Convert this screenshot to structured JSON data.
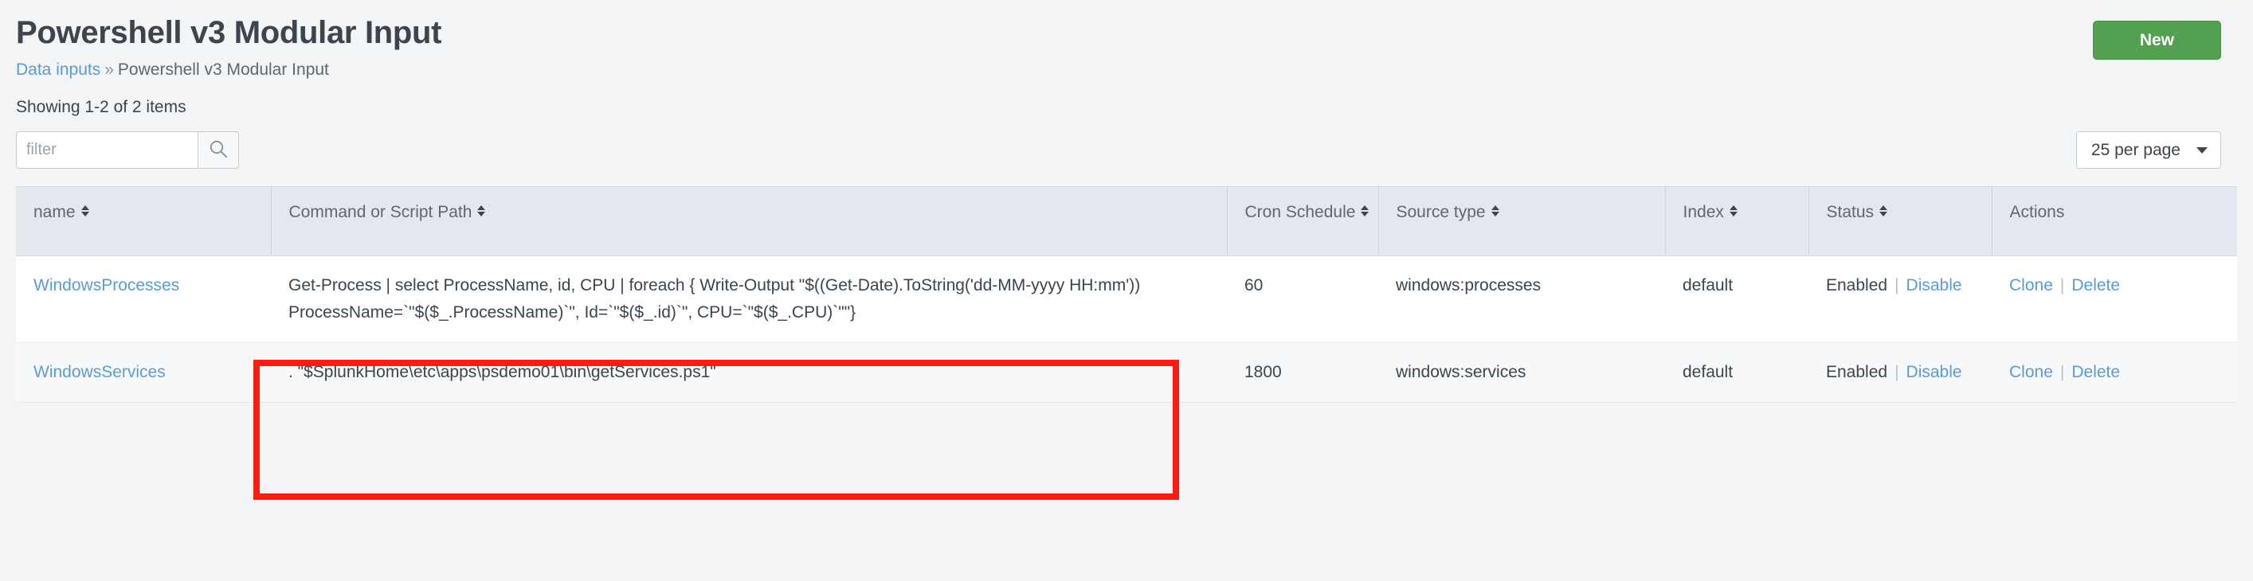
{
  "header": {
    "title": "Powershell v3 Modular Input",
    "breadcrumb": {
      "parent": "Data inputs",
      "separator": "»",
      "current": "Powershell v3 Modular Input"
    },
    "new_button_label": "New"
  },
  "controls": {
    "showing_text": "Showing 1-2 of 2 items",
    "filter_placeholder": "filter",
    "filter_value": "",
    "search_icon": "search-icon",
    "per_page_label": "25 per page",
    "caret_icon": "chevron-down-icon"
  },
  "table": {
    "columns": [
      {
        "label": "name",
        "sortable": true
      },
      {
        "label": "Command or Script Path",
        "sortable": true
      },
      {
        "label": "Cron Schedule",
        "sortable": true
      },
      {
        "label": "Source type",
        "sortable": true
      },
      {
        "label": "Index",
        "sortable": true
      },
      {
        "label": "Status",
        "sortable": true
      },
      {
        "label": "Actions",
        "sortable": false
      }
    ],
    "rows": [
      {
        "name": "WindowsProcesses",
        "command": "Get-Process | select ProcessName, id, CPU | foreach { Write-Output \"$((Get-Date).ToString('dd-MM-yyyy HH:mm')) ProcessName=`\"$($_.ProcessName)`\", Id=`\"$($_.id)`\", CPU=`\"$($_.CPU)`\"\"}",
        "cron": "60",
        "source_type": "windows:processes",
        "index": "default",
        "status": "Enabled",
        "status_toggle": "Disable",
        "action_clone": "Clone",
        "action_delete": "Delete"
      },
      {
        "name": "WindowsServices",
        "command": ". \"$SplunkHome\\etc\\apps\\psdemo01\\bin\\getServices.ps1\"",
        "cron": "1800",
        "source_type": "windows:services",
        "index": "default",
        "status": "Enabled",
        "status_toggle": "Disable",
        "action_clone": "Clone",
        "action_delete": "Delete"
      }
    ]
  },
  "annotation": {
    "color": "#fd1e10",
    "target": "command-cell-row-1"
  },
  "colors": {
    "accent_link": "#5b9bd5",
    "new_button": "#53a051",
    "page_background": "#f2f4f5",
    "header_background": "#e4e8ee",
    "annotation_red": "#fd1e10"
  }
}
